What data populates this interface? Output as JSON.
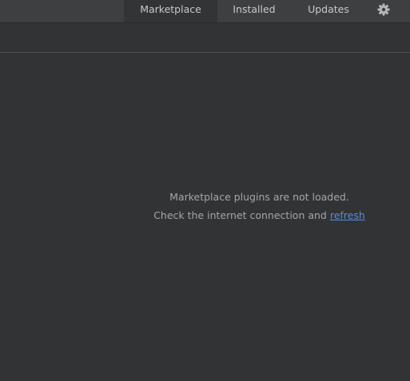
{
  "tabs": [
    {
      "label": "Marketplace",
      "selected": true
    },
    {
      "label": "Installed",
      "selected": false
    },
    {
      "label": "Updates",
      "selected": false
    }
  ],
  "settings_icon": "gear-icon",
  "search": {
    "value": "",
    "placeholder": ""
  },
  "empty_state": {
    "line1": "Marketplace plugins are not loaded.",
    "line2_prefix": "Check the internet connection and ",
    "refresh_link": "refresh"
  },
  "colors": {
    "background": "#323335",
    "tabbar": "#3d3f41",
    "text": "#a3a6a8",
    "link": "#5a8dd6"
  }
}
